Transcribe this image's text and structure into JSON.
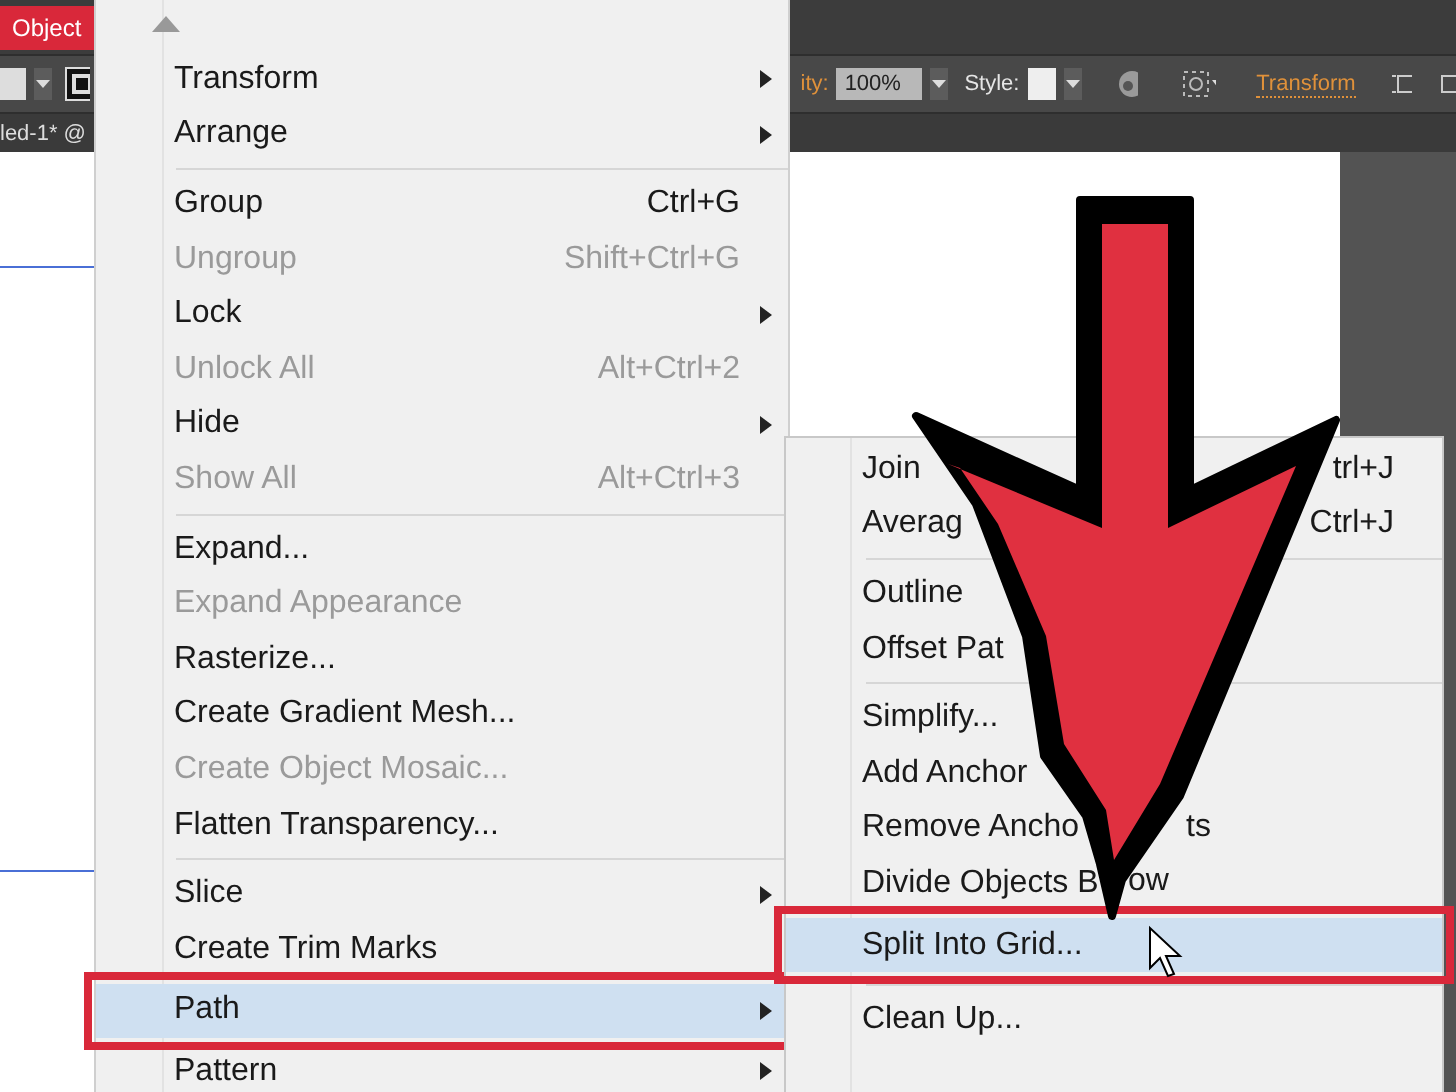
{
  "menubar": {
    "items": [
      {
        "label": "Object",
        "selected": true
      }
    ]
  },
  "control_bar": {
    "opacity_label": "ity:",
    "opacity_value": "100%",
    "style_label": "Style:",
    "transform_link": "Transform"
  },
  "document_tab": {
    "title": "led-1* @"
  },
  "object_menu": {
    "items": [
      {
        "kind": "item",
        "label": "Transform",
        "submenu": true,
        "disabled": false,
        "selected": false
      },
      {
        "kind": "item",
        "label": "Arrange",
        "submenu": true,
        "disabled": false,
        "selected": false
      },
      {
        "kind": "separator"
      },
      {
        "kind": "item",
        "label": "Group",
        "shortcut": "Ctrl+G",
        "disabled": false,
        "selected": false
      },
      {
        "kind": "item",
        "label": "Ungroup",
        "shortcut": "Shift+Ctrl+G",
        "disabled": true,
        "selected": false
      },
      {
        "kind": "item",
        "label": "Lock",
        "submenu": true,
        "disabled": false,
        "selected": false
      },
      {
        "kind": "item",
        "label": "Unlock All",
        "shortcut": "Alt+Ctrl+2",
        "disabled": true,
        "selected": false
      },
      {
        "kind": "item",
        "label": "Hide",
        "submenu": true,
        "disabled": false,
        "selected": false
      },
      {
        "kind": "item",
        "label": "Show All",
        "shortcut": "Alt+Ctrl+3",
        "disabled": true,
        "selected": false
      },
      {
        "kind": "separator"
      },
      {
        "kind": "item",
        "label": "Expand...",
        "disabled": false,
        "selected": false
      },
      {
        "kind": "item",
        "label": "Expand Appearance",
        "disabled": true,
        "selected": false
      },
      {
        "kind": "item",
        "label": "Rasterize...",
        "disabled": false,
        "selected": false
      },
      {
        "kind": "item",
        "label": "Create Gradient Mesh...",
        "disabled": false,
        "selected": false
      },
      {
        "kind": "item",
        "label": "Create Object Mosaic...",
        "disabled": true,
        "selected": false
      },
      {
        "kind": "item",
        "label": "Flatten Transparency...",
        "disabled": false,
        "selected": false
      },
      {
        "kind": "separator"
      },
      {
        "kind": "item",
        "label": "Slice",
        "submenu": true,
        "disabled": false,
        "selected": false
      },
      {
        "kind": "item",
        "label": "Create Trim Marks",
        "disabled": false,
        "selected": false
      },
      {
        "kind": "item",
        "label": "Path",
        "submenu": true,
        "disabled": false,
        "selected": true
      },
      {
        "kind": "item",
        "label": "Pattern",
        "submenu": true,
        "disabled": false,
        "selected": false
      }
    ]
  },
  "path_submenu": {
    "items": [
      {
        "kind": "item",
        "label": "Join",
        "shortcut": "trl+J",
        "selected": false
      },
      {
        "kind": "item",
        "label": "Averag",
        "shortcut": "Ctrl+J",
        "selected": false
      },
      {
        "kind": "separator"
      },
      {
        "kind": "item",
        "label": "Outline",
        "selected": false
      },
      {
        "kind": "item",
        "label": "Offset Pat",
        "selected": false
      },
      {
        "kind": "separator"
      },
      {
        "kind": "item",
        "label": "Simplify...",
        "selected": false
      },
      {
        "kind": "item",
        "label": "Add Anchor",
        "selected": false
      },
      {
        "kind": "item",
        "label": "Remove Ancho",
        "tail": "ts",
        "selected": false
      },
      {
        "kind": "item",
        "label": "Divide Objects B",
        "tail": "ow",
        "selected": false
      },
      {
        "kind": "item",
        "label": "Split Into Grid...",
        "selected": true
      },
      {
        "kind": "separator"
      },
      {
        "kind": "item",
        "label": "Clean Up...",
        "selected": false
      }
    ]
  }
}
